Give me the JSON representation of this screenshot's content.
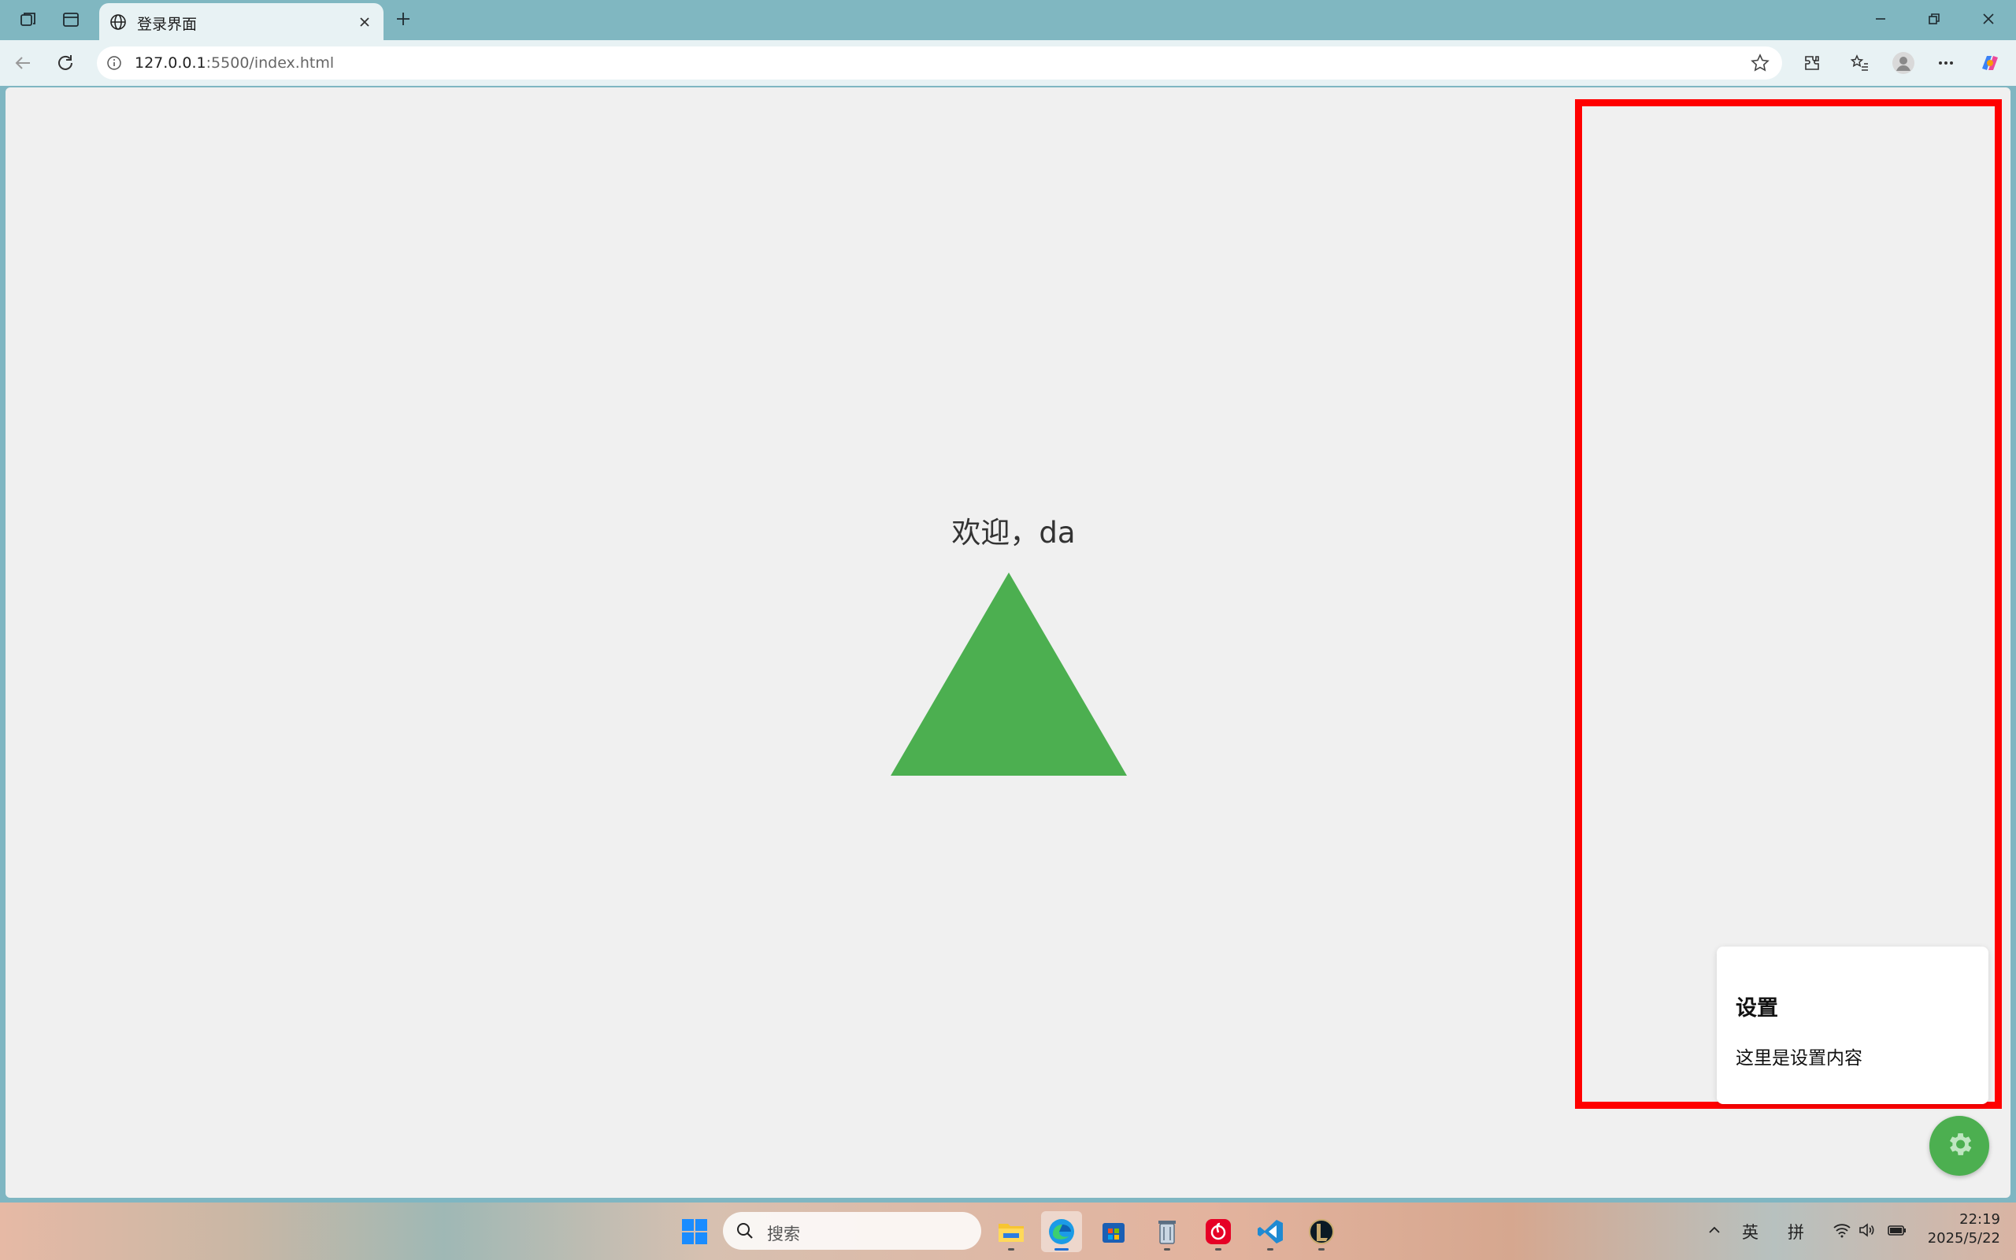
{
  "browser": {
    "tab": {
      "title": "登录界面"
    },
    "address": {
      "host": "127.0.0.1",
      "rest": ":5500/index.html"
    }
  },
  "page": {
    "welcome_text": "欢迎，da",
    "triangle_color": "#4caf50",
    "settings": {
      "title": "设置",
      "body": "这里是设置内容"
    },
    "highlight_color": "#ff0000"
  },
  "taskbar": {
    "search_placeholder": "搜索",
    "ime_lang": "英",
    "ime_mode": "拼",
    "time": "22:19",
    "date": "2025/5/22"
  }
}
